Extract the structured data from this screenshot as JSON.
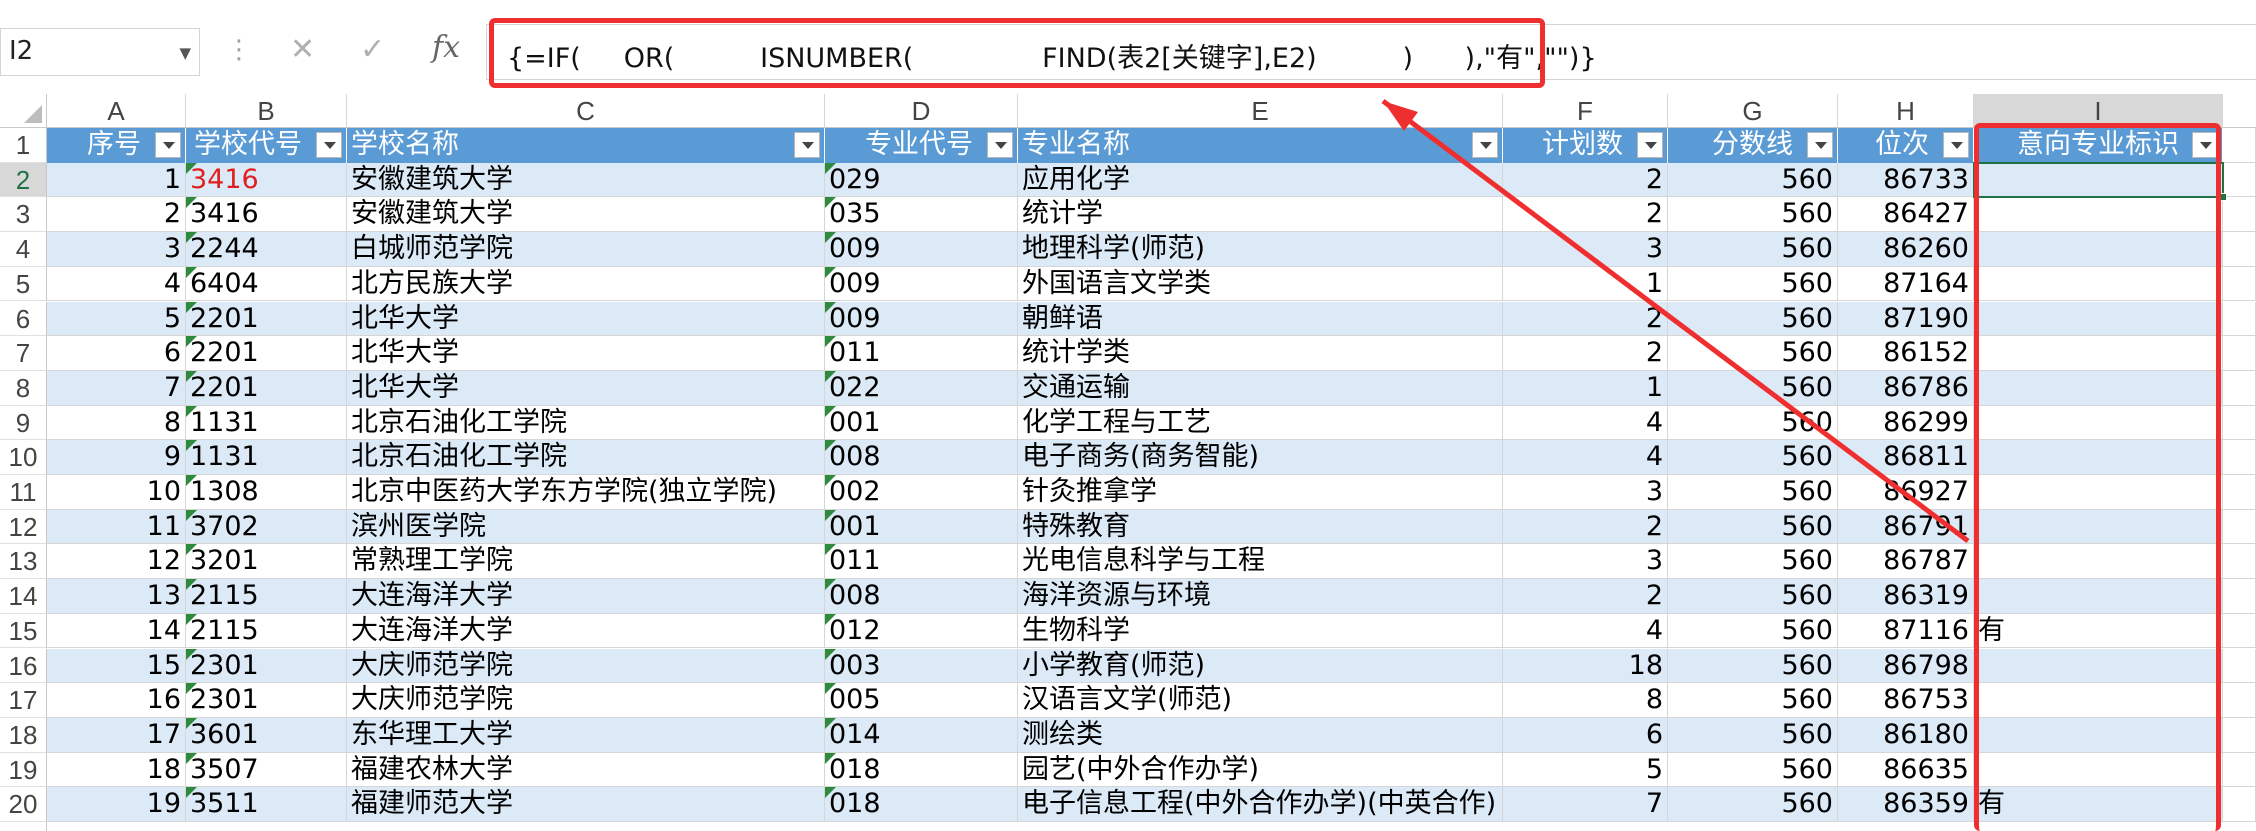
{
  "name_box": {
    "value": "I2"
  },
  "formula_bar": {
    "fx_label": "fx",
    "cancel_glyph": "✕",
    "enter_glyph": "✓",
    "formula": "{=IF(     OR(          ISNUMBER(               FIND(表2[关键字],E2)          )      ),\"有\",\"\")}"
  },
  "columns": [
    "A",
    "B",
    "C",
    "D",
    "E",
    "F",
    "G",
    "H",
    "I"
  ],
  "table_header": [
    "序号",
    "学校代号",
    "学校名称",
    "专业代号",
    "专业名称",
    "计划数",
    "分数线",
    "位次",
    "意向专业标识"
  ],
  "rows": [
    {
      "row": "1"
    },
    {
      "row": "2",
      "cells": [
        "1",
        "3416",
        "安徽建筑大学",
        "029",
        "应用化学",
        "2",
        "560",
        "86733",
        ""
      ]
    },
    {
      "row": "3",
      "cells": [
        "2",
        "3416",
        "安徽建筑大学",
        "035",
        "统计学",
        "2",
        "560",
        "86427",
        ""
      ]
    },
    {
      "row": "4",
      "cells": [
        "3",
        "2244",
        "白城师范学院",
        "009",
        "地理科学(师范)",
        "3",
        "560",
        "86260",
        ""
      ]
    },
    {
      "row": "5",
      "cells": [
        "4",
        "6404",
        "北方民族大学",
        "009",
        "外国语言文学类",
        "1",
        "560",
        "87164",
        ""
      ]
    },
    {
      "row": "6",
      "cells": [
        "5",
        "2201",
        "北华大学",
        "009",
        "朝鲜语",
        "2",
        "560",
        "87190",
        ""
      ]
    },
    {
      "row": "7",
      "cells": [
        "6",
        "2201",
        "北华大学",
        "011",
        "统计学类",
        "2",
        "560",
        "86152",
        ""
      ]
    },
    {
      "row": "8",
      "cells": [
        "7",
        "2201",
        "北华大学",
        "022",
        "交通运输",
        "1",
        "560",
        "86786",
        ""
      ]
    },
    {
      "row": "9",
      "cells": [
        "8",
        "1131",
        "北京石油化工学院",
        "001",
        "化学工程与工艺",
        "4",
        "560",
        "86299",
        ""
      ]
    },
    {
      "row": "10",
      "cells": [
        "9",
        "1131",
        "北京石油化工学院",
        "008",
        "电子商务(商务智能)",
        "4",
        "560",
        "86811",
        ""
      ]
    },
    {
      "row": "11",
      "cells": [
        "10",
        "1308",
        "北京中医药大学东方学院(独立学院)",
        "002",
        "针灸推拿学",
        "3",
        "560",
        "86927",
        ""
      ]
    },
    {
      "row": "12",
      "cells": [
        "11",
        "3702",
        "滨州医学院",
        "001",
        "特殊教育",
        "2",
        "560",
        "86791",
        ""
      ]
    },
    {
      "row": "13",
      "cells": [
        "12",
        "3201",
        "常熟理工学院",
        "011",
        "光电信息科学与工程",
        "3",
        "560",
        "86787",
        ""
      ]
    },
    {
      "row": "14",
      "cells": [
        "13",
        "2115",
        "大连海洋大学",
        "008",
        "海洋资源与环境",
        "2",
        "560",
        "86319",
        ""
      ]
    },
    {
      "row": "15",
      "cells": [
        "14",
        "2115",
        "大连海洋大学",
        "012",
        "生物科学",
        "4",
        "560",
        "87116",
        "有"
      ]
    },
    {
      "row": "16",
      "cells": [
        "15",
        "2301",
        "大庆师范学院",
        "003",
        "小学教育(师范)",
        "18",
        "560",
        "86798",
        ""
      ]
    },
    {
      "row": "17",
      "cells": [
        "16",
        "2301",
        "大庆师范学院",
        "005",
        "汉语言文学(师范)",
        "8",
        "560",
        "86753",
        ""
      ]
    },
    {
      "row": "18",
      "cells": [
        "17",
        "3601",
        "东华理工大学",
        "014",
        "测绘类",
        "6",
        "560",
        "86180",
        ""
      ]
    },
    {
      "row": "19",
      "cells": [
        "18",
        "3507",
        "福建农林大学",
        "018",
        "园艺(中外合作办学)",
        "5",
        "560",
        "86635",
        ""
      ]
    },
    {
      "row": "20",
      "cells": [
        "19",
        "3511",
        "福建师范大学",
        "018",
        "电子信息工程(中外合作办学)(中英合作)",
        "7",
        "560",
        "86359",
        "有"
      ]
    }
  ],
  "colors": {
    "header_fill": "#5b9bd5",
    "band_fill": "#dce9f6",
    "highlight_red": "#ef2f2f",
    "selection_green": "#217346",
    "red_text": "#e02020"
  }
}
